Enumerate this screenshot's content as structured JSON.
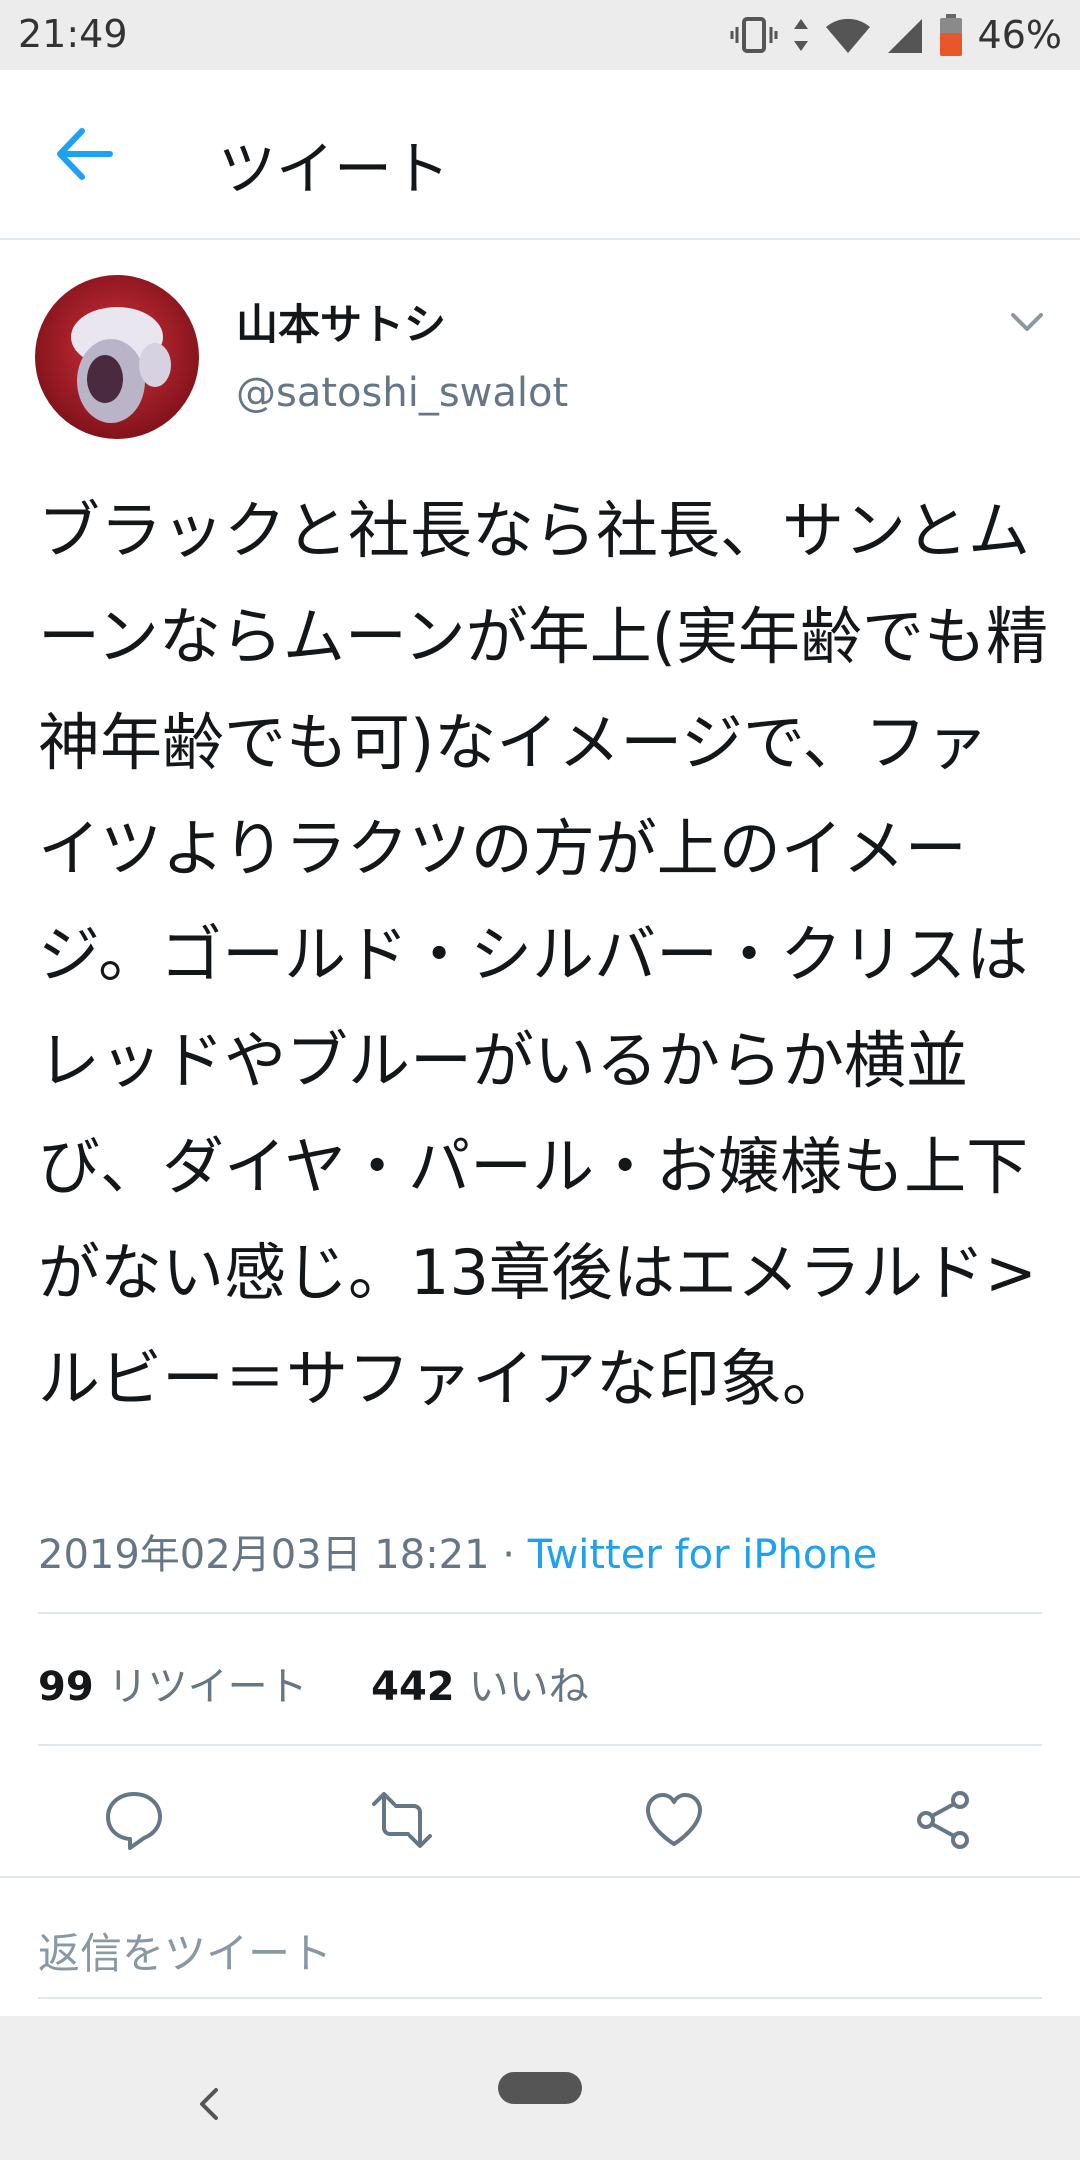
{
  "status_bar": {
    "time": "21:49",
    "battery": "46%",
    "icons": [
      "vibrate-icon",
      "data-arrows-icon",
      "wifi-icon",
      "signal-icon",
      "battery-icon"
    ]
  },
  "app_bar": {
    "back_icon": "arrow-left-icon",
    "title": "ツイート"
  },
  "tweet": {
    "author": {
      "name": "山本サトシ",
      "handle": "@satoshi_swalot"
    },
    "menu_icon": "chevron-down-icon",
    "text": "ブラックと社長なら社長、サンとムーンならムーンが年上(実年齢でも精神年齢でも可)なイメージで、ファイツよりラクツの方が上のイメージ。ゴールド・シルバー・クリスはレッドやブルーがいるからか横並び、ダイヤ・パール・お嬢様も上下がない感じ。13章後はエメラルド>ルビー＝サファイアな印象。",
    "timestamp": "2019年02月03日 18:21",
    "separator": " · ",
    "source": "Twitter for iPhone",
    "stats": {
      "retweets": "99",
      "retweets_label": "リツイート",
      "likes": "442",
      "likes_label": "いいね"
    },
    "actions": [
      "reply-icon",
      "retweet-icon",
      "like-icon",
      "share-icon"
    ]
  },
  "reply_box": {
    "placeholder": "返信をツイート"
  },
  "colors": {
    "accent": "#1da1f2",
    "secondary_text": "#657786",
    "primary_text": "#14171a",
    "divider": "#e1e8ed"
  }
}
